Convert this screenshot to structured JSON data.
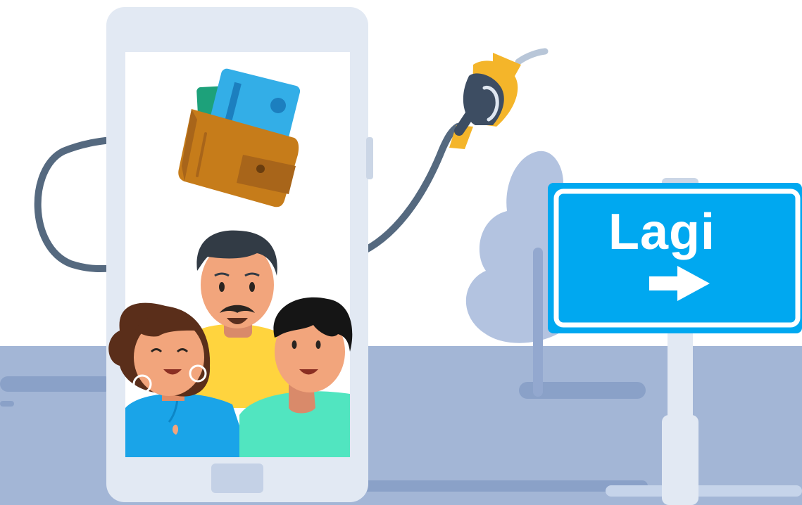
{
  "sign": {
    "label": "Lagi",
    "arrow_icon": "arrow-right-icon"
  },
  "palette": {
    "ground": "#a3b6d6",
    "phone_frame": "#e2e9f3",
    "sign_blue": "#00a8f0",
    "hose": "#55697f",
    "nozzle_yellow": "#f4b52a",
    "wallet": "#c67c1a",
    "card_blue": "#33aee7",
    "cash_green": "#1da17a"
  },
  "icons": [
    "wallet-icon",
    "fuel-nozzle-icon",
    "road-sign-icon",
    "bush-icon",
    "family-illustration"
  ]
}
